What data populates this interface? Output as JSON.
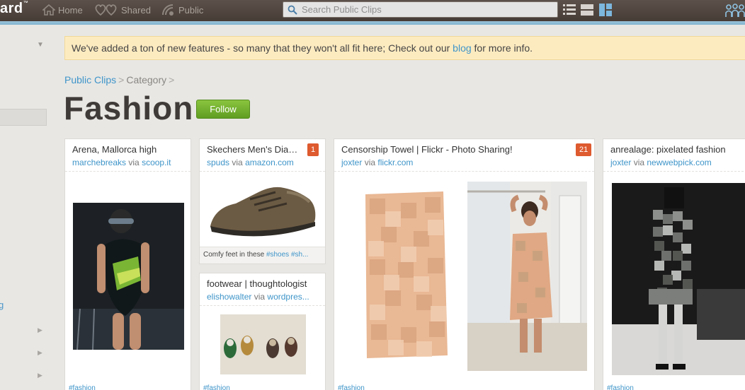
{
  "topbar": {
    "brand": "ard",
    "nav": [
      {
        "label": "Home",
        "icon": "home-icon"
      },
      {
        "label": "Shared",
        "icon": "shared-icon"
      },
      {
        "label": "Public",
        "icon": "public-icon"
      }
    ],
    "search_placeholder": "Search Public Clips",
    "view_icons": [
      "list-view-icon",
      "compact-view-icon",
      "grid-view-icon"
    ]
  },
  "notice": {
    "text_before": "We've added a ton of new features - so many that they won't all fit here; Check out our ",
    "link": "blog",
    "text_after": " for more info."
  },
  "sidebar": {
    "link": "g"
  },
  "breadcrumb": {
    "root": "Public Clips",
    "sep": ">",
    "category": "Category"
  },
  "page_title": "Fashion",
  "follow_label": "Follow",
  "cards": [
    {
      "title": "Arena, Mallorca high",
      "user": "marchebreaks",
      "via": "via",
      "source": "scoop.it",
      "tag": "#fashion"
    },
    {
      "title": "Skechers Men's Diam...",
      "badge": "1",
      "user": "spuds",
      "via": "via",
      "source": "amazon.com",
      "caption_text": "Comfy feet in these ",
      "caption_tags": "#shoes #sh..."
    },
    {
      "title": "footwear | thoughtologist",
      "user": "elishowalter",
      "via": "via",
      "source": "wordpres...",
      "tag": "#fashion"
    },
    {
      "title": "Censorship Towel | Flickr - Photo Sharing!",
      "badge": "21",
      "user": "joxter",
      "via": "via",
      "source": "flickr.com",
      "tag": "#fashion"
    },
    {
      "title": "anrealage: pixelated fashion",
      "user": "joxter",
      "via": "via",
      "source": "newwebpick.com",
      "tag": "#fashion"
    }
  ],
  "colors": {
    "accent": "#3f95c9",
    "follow_green": "#6fae2c",
    "badge": "#de5a2f",
    "topbar": "#4f4540"
  }
}
